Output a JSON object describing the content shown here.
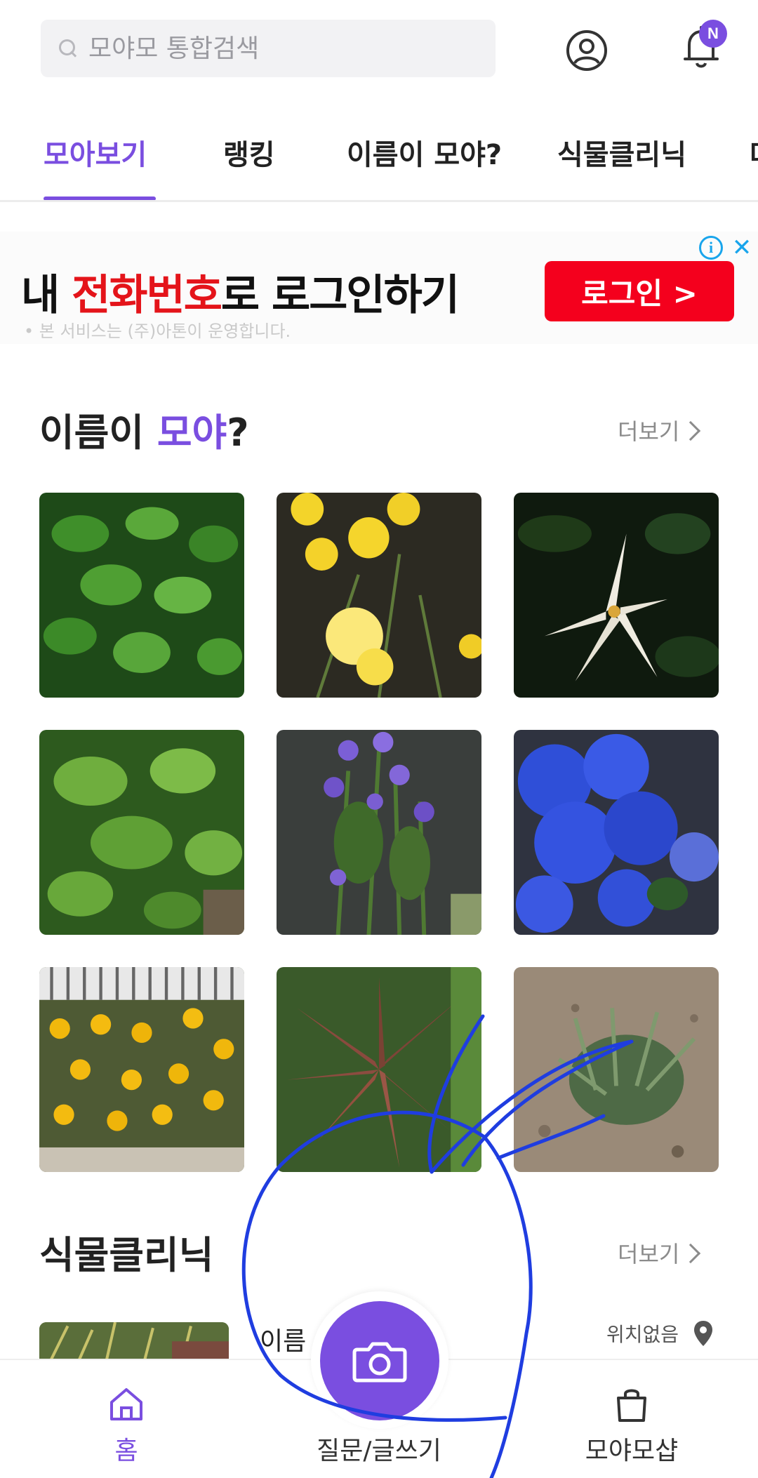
{
  "search": {
    "placeholder": "모야모 통합검색",
    "value": ""
  },
  "header": {
    "profile_icon": "user-circle-icon",
    "notification_icon": "bell-icon",
    "notification_badge": "N"
  },
  "tabs": [
    {
      "label": "모아보기",
      "active": true
    },
    {
      "label": "랭킹",
      "active": false
    },
    {
      "label": "이름이 모야?",
      "active": false
    },
    {
      "label": "식물클리닉",
      "active": false
    },
    {
      "label": "다",
      "active": false
    }
  ],
  "ad": {
    "title_prefix": "내 ",
    "title_highlight": "전화번호",
    "title_suffix": "로 로그인하기",
    "subtitle": "• 본 서비스는 (주)아톤이 운영합니다.",
    "button_label": "로그인 >",
    "info_label": "i",
    "close_label": "✕",
    "accent_color": "#e4141a"
  },
  "name_section": {
    "title_prefix": "이름이 ",
    "title_accent": "모야",
    "title_suffix": "?",
    "more_label": "더보기",
    "photos": [
      "green-leafy-shrub",
      "yellow-coreopsis-flowers",
      "white-gardenia-flower",
      "green-leaf-groundcover",
      "purple-aster-flowers",
      "blue-hydrangea",
      "yellow-black-eyed-susans",
      "bronze-leaf-plant",
      "ornamental-grass-clump"
    ]
  },
  "clinic_section": {
    "title": "식물클리닉",
    "more_label": "더보기",
    "item_title": "이름",
    "location": "위치없음"
  },
  "bottom_nav": {
    "home_label": "홈",
    "write_label": "질문/글쓰기",
    "shop_label": "모야모샵",
    "camera_icon": "camera-icon"
  },
  "colors": {
    "accent": "#7a4ee0",
    "annotation": "#1f3de0",
    "ad_button": "#f4001d"
  }
}
